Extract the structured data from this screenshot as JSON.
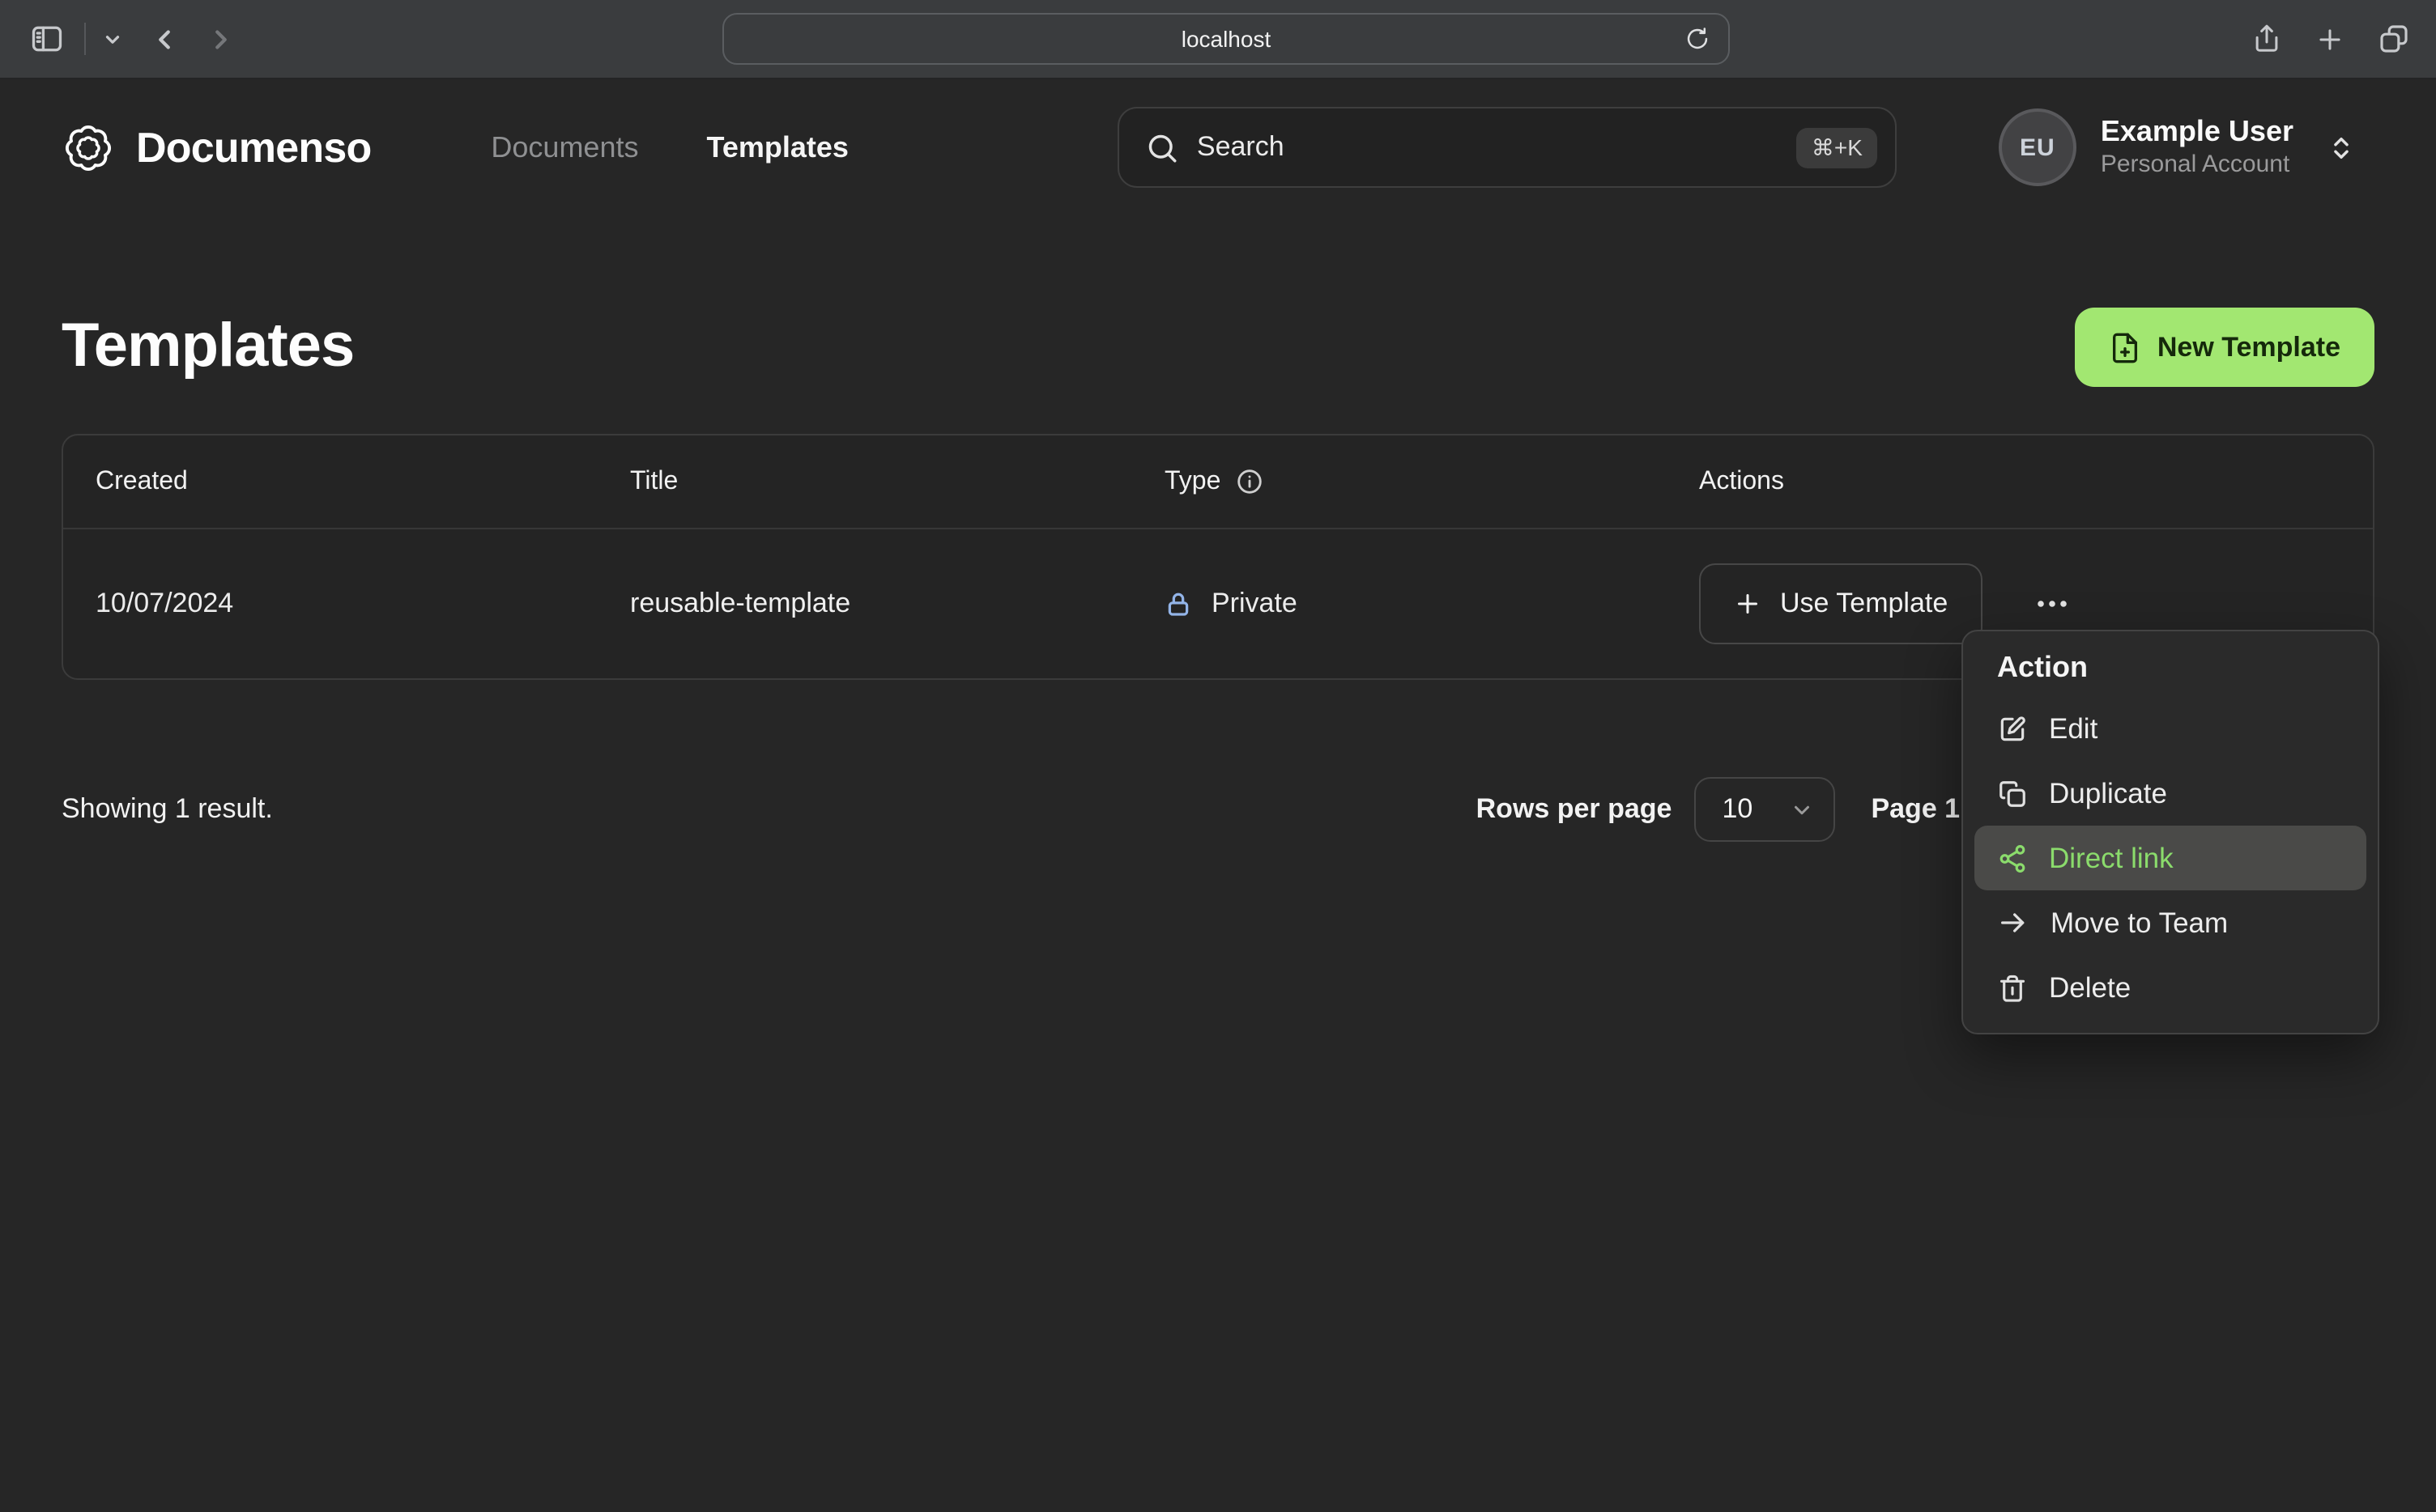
{
  "browser": {
    "url": "localhost"
  },
  "header": {
    "brand": "Documenso",
    "nav": {
      "documents": "Documents",
      "templates": "Templates"
    },
    "search": {
      "placeholder": "Search",
      "shortcut": "⌘+K"
    },
    "user": {
      "initials": "EU",
      "name": "Example User",
      "account": "Personal Account"
    }
  },
  "page": {
    "title": "Templates",
    "new_template_label": "New Template",
    "table": {
      "columns": {
        "created": "Created",
        "title": "Title",
        "type": "Type",
        "actions": "Actions"
      },
      "row": {
        "created": "10/07/2024",
        "title": "reusable-template",
        "type": "Private",
        "use_template_label": "Use Template"
      }
    },
    "footer": {
      "summary": "Showing 1 result.",
      "rows_per_page_label": "Rows per page",
      "rows_per_page_value": "10",
      "page_indicator": "Page 1 of 1"
    }
  },
  "action_menu": {
    "title": "Action",
    "items": [
      {
        "label": "Edit",
        "icon": "square-pen-icon",
        "highlighted": false
      },
      {
        "label": "Duplicate",
        "icon": "copy-icon",
        "highlighted": false
      },
      {
        "label": "Direct link",
        "icon": "share-nodes-icon",
        "highlighted": true
      },
      {
        "label": "Move to Team",
        "icon": "arrow-right-icon",
        "highlighted": false
      },
      {
        "label": "Delete",
        "icon": "trash-icon",
        "highlighted": false
      }
    ]
  },
  "colors": {
    "brand_green": "#a2e771",
    "menu_highlight_green": "#8bdc6c",
    "lock_blue": "#93b4e8",
    "page_background": "#262626",
    "browser_chrome": "#3a3c3e"
  }
}
